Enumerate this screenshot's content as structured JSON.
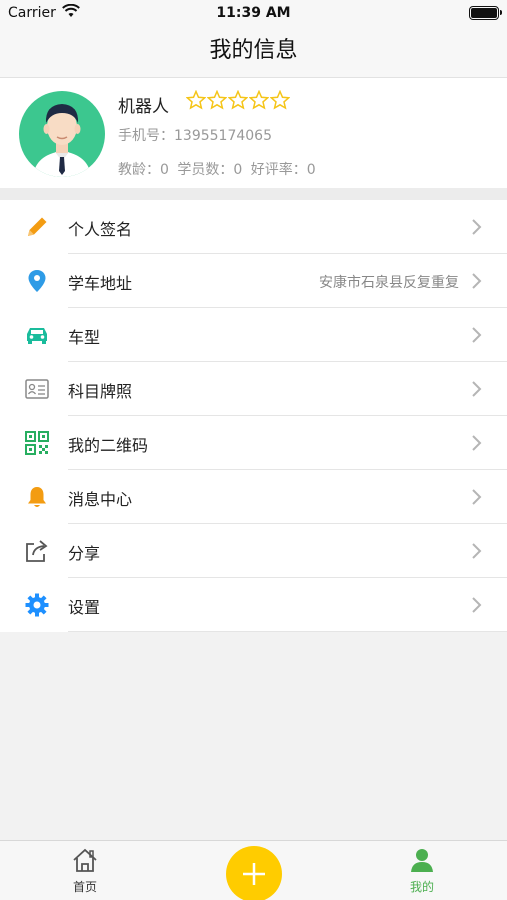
{
  "status_bar": {
    "carrier": "Carrier",
    "time": "11:39 AM"
  },
  "nav": {
    "title": "我的信息"
  },
  "profile": {
    "name": "机器人",
    "rating_stars": 0,
    "rating_max": 5,
    "phone": "手机号：13955174065",
    "stats": {
      "teaching_years": "教龄：0",
      "students": "学员数：0",
      "positive_rate": "好评率：0"
    }
  },
  "menu": {
    "items": [
      {
        "label": "个人签名",
        "icon": "pencil-icon",
        "value": ""
      },
      {
        "label": "学车地址",
        "icon": "location-pin-icon",
        "value": "安康市石泉县反复重复"
      },
      {
        "label": "车型",
        "icon": "car-icon",
        "value": ""
      },
      {
        "label": "科目牌照",
        "icon": "id-card-icon",
        "value": ""
      },
      {
        "label": "我的二维码",
        "icon": "qr-code-icon",
        "value": ""
      },
      {
        "label": "消息中心",
        "icon": "bell-icon",
        "value": ""
      },
      {
        "label": "分享",
        "icon": "share-icon",
        "value": ""
      },
      {
        "label": "设置",
        "icon": "gear-icon",
        "value": ""
      }
    ]
  },
  "tab_bar": {
    "home_label": "首页",
    "me_label": "我的",
    "add_icon": "plus-icon"
  },
  "colors": {
    "accent_green": "#3cc78f",
    "tab_active": "#4caf50",
    "fab_yellow": "#ffcc00",
    "star_yellow": "#f5c518",
    "pencil_orange": "#f39c12",
    "pin_blue": "#2e9be6",
    "gear_blue": "#1e90ff",
    "bell_orange": "#f39c12"
  }
}
